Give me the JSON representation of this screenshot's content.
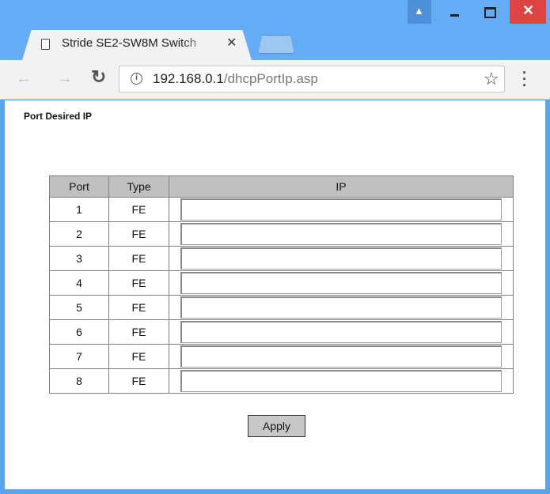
{
  "browser": {
    "tab_title": "Stride SE2-SW8M Switch",
    "tab_close": "✕",
    "url_host": "192.168.0.1",
    "url_path": "/dhcpPortIp.asp",
    "colors": {
      "frame": "#64acf5",
      "close": "#e04343"
    }
  },
  "page": {
    "title": "Port Desired IP",
    "table": {
      "headers": [
        "Port",
        "Type",
        "IP"
      ],
      "rows": [
        {
          "port": "1",
          "type": "FE",
          "ip": ""
        },
        {
          "port": "2",
          "type": "FE",
          "ip": ""
        },
        {
          "port": "3",
          "type": "FE",
          "ip": ""
        },
        {
          "port": "4",
          "type": "FE",
          "ip": ""
        },
        {
          "port": "5",
          "type": "FE",
          "ip": ""
        },
        {
          "port": "6",
          "type": "FE",
          "ip": ""
        },
        {
          "port": "7",
          "type": "FE",
          "ip": ""
        },
        {
          "port": "8",
          "type": "FE",
          "ip": ""
        }
      ]
    },
    "apply_label": "Apply"
  }
}
